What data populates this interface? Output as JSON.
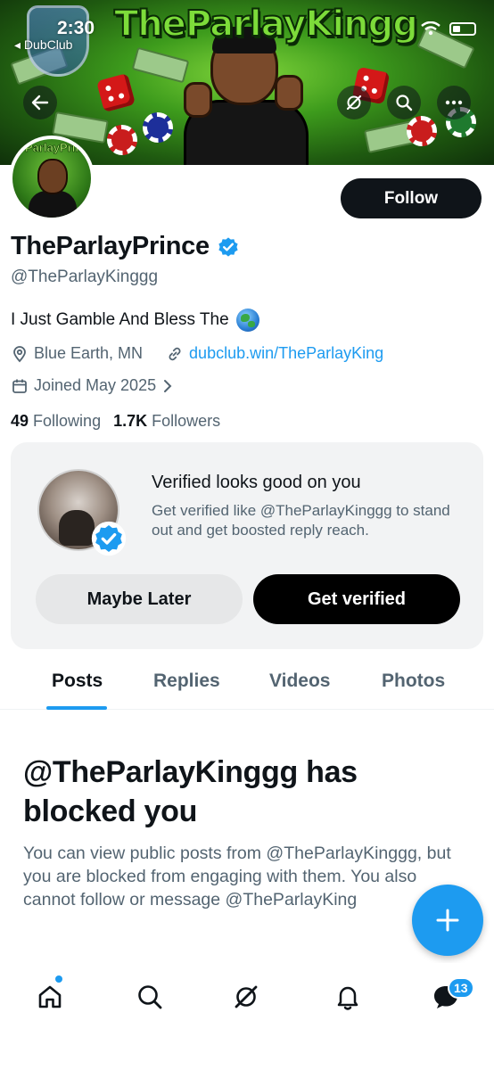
{
  "status_bar": {
    "time": "2:30",
    "back_app": "◂ DubClub"
  },
  "banner": {
    "title_text": "TheParlayKingg"
  },
  "avatar": {
    "text": "ParlayPrin"
  },
  "profile": {
    "follow_label": "Follow",
    "display_name": "TheParlayPrince",
    "handle": "@TheParlayKinggg",
    "bio": "I Just Gamble And Bless The",
    "location": "Blue Earth, MN",
    "website": "dubclub.win/TheParlayKing",
    "joined": "Joined May 2025",
    "following_count": "49",
    "following_label": "Following",
    "followers_count": "1.7K",
    "followers_label": "Followers"
  },
  "verify_card": {
    "title": "Verified looks good on you",
    "description": "Get verified like @TheParlayKinggg to stand out and get boosted reply reach.",
    "maybe_later": "Maybe Later",
    "get_verified": "Get verified"
  },
  "tabs": [
    {
      "label": "Posts",
      "active": true
    },
    {
      "label": "Replies",
      "active": false
    },
    {
      "label": "Videos",
      "active": false
    },
    {
      "label": "Photos",
      "active": false
    }
  ],
  "blocked": {
    "title": "@TheParlayKinggg has blocked you",
    "description": "You can view public posts from @TheParlayKinggg, but you are blocked from engaging with them. You also cannot follow or message @TheParlayKing"
  },
  "bottom_nav": {
    "messages_badge": "13"
  },
  "colors": {
    "accent": "#1d9bf0",
    "text_primary": "#0f1419",
    "text_secondary": "#536471",
    "card_bg": "#f2f3f4"
  },
  "icons": [
    "back-arrow-icon",
    "grok-icon",
    "search-icon",
    "more-icon",
    "verified-badge-icon",
    "location-icon",
    "link-icon",
    "calendar-icon",
    "chevron-right-icon",
    "plus-icon",
    "home-icon",
    "notifications-icon",
    "messages-icon"
  ]
}
